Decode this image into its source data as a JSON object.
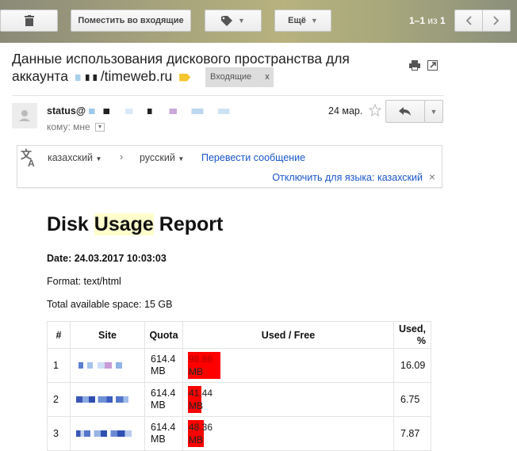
{
  "toolbar": {
    "move_inbox_label": "Поместить во входящие",
    "more_label": "Ещё",
    "pager_range": "1–1",
    "pager_of": "из",
    "pager_total": "1"
  },
  "subject": {
    "line1": "Данные использования дискового пространства для",
    "line2_prefix": "аккаунта",
    "line2_suffix": "/timeweb.ru",
    "label": "Входящие",
    "label_close": "x"
  },
  "message": {
    "sender": "status@",
    "date": "24 мар.",
    "to_label": "кому: мне"
  },
  "translate_bar": {
    "from_lang": "казахский",
    "to_lang": "русский",
    "translate_link": "Перевести сообщение",
    "disable_link": "Отключить для языка: казахский"
  },
  "report": {
    "title_pre": "Disk ",
    "title_hl": "Usage",
    "title_post": " Report",
    "date": "Date: 24.03.2017 10:03:03",
    "format": "Format: text/html",
    "total": "Total available space: 15 GB",
    "headers": {
      "num": "#",
      "site": "Site",
      "quota": "Quota",
      "used_free": "Used / Free",
      "used_pct": "Used, %"
    },
    "rows": [
      {
        "num": "1",
        "quota_1": "614.4",
        "quota_2": "MB",
        "used": "98.86",
        "free": "MB",
        "pct": "16.09",
        "pct_fraction": 0.1609
      },
      {
        "num": "2",
        "quota_1": "614.4",
        "quota_2": "MB",
        "used": "41.44",
        "free": "MB",
        "pct": "6.75",
        "pct_fraction": 0.0675
      },
      {
        "num": "3",
        "quota_1": "614.4",
        "quota_2": "MB",
        "used": "48.36",
        "free": "MB",
        "pct": "7.87",
        "pct_fraction": 0.0787
      }
    ]
  },
  "colors": {
    "accent_link": "#1a56c8",
    "bar_used": "#ff0000",
    "highlight": "#ffffcc"
  }
}
